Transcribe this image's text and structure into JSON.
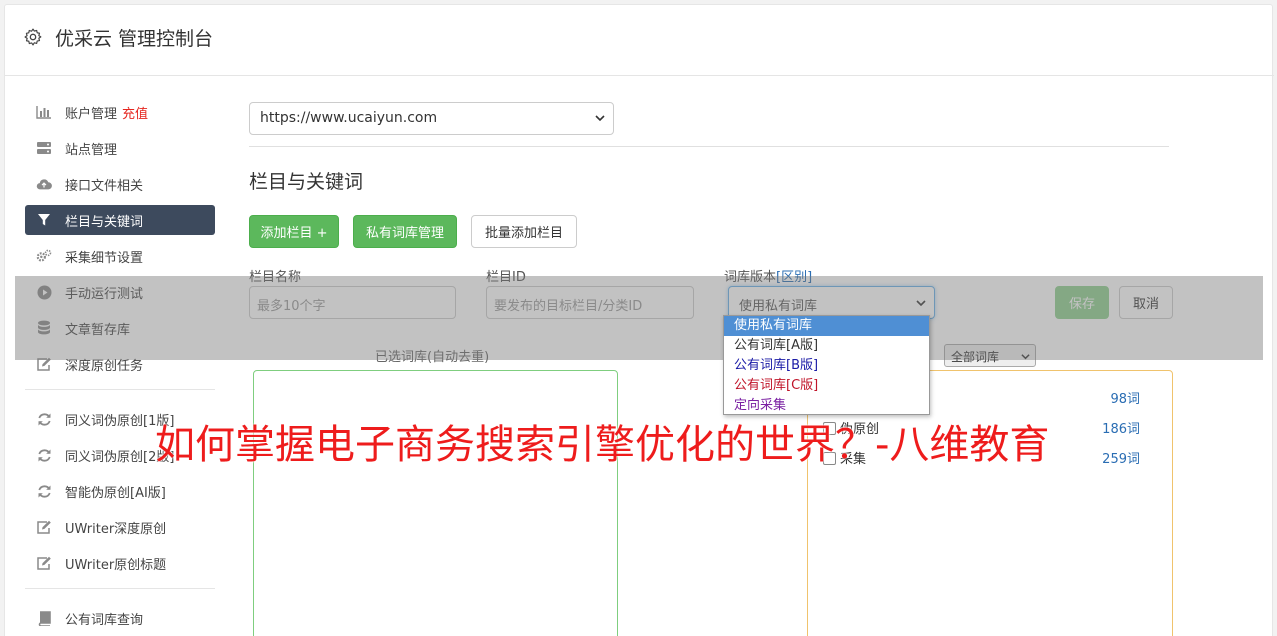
{
  "header": {
    "title": "优采云 管理控制台",
    "icon": "gear-icon"
  },
  "sidebar": {
    "items": [
      {
        "label": "账户管理",
        "badge": "充值",
        "icon": "bar-chart-icon"
      },
      {
        "label": "站点管理",
        "icon": "server-icon"
      },
      {
        "label": "接口文件相关",
        "icon": "cloud-upload-icon"
      },
      {
        "label": "栏目与关键词",
        "icon": "filter-icon",
        "active": true
      },
      {
        "label": "采集细节设置",
        "icon": "cogs-icon"
      },
      {
        "label": "手动运行测试",
        "icon": "play-circle-icon"
      },
      {
        "label": "文章暂存库",
        "icon": "database-icon"
      },
      {
        "label": "深度原创任务",
        "icon": "edit-icon"
      }
    ],
    "items2": [
      {
        "label": "同义词伪原创[1版]",
        "icon": "refresh-icon"
      },
      {
        "label": "同义词伪原创[2版]",
        "icon": "refresh-icon"
      },
      {
        "label": "智能伪原创[AI版]",
        "icon": "refresh-icon"
      },
      {
        "label": "UWriter深度原创",
        "icon": "edit-icon"
      },
      {
        "label": "UWriter原创标题",
        "icon": "edit-icon"
      }
    ],
    "items3": [
      {
        "label": "公有词库查询",
        "icon": "book-icon"
      }
    ]
  },
  "main": {
    "site_select": "https://www.ucaiyun.com",
    "section_title": "栏目与关键词",
    "buttons": {
      "add_column": "添加栏目 +",
      "private_lib": "私有词库管理",
      "batch_add": "批量添加栏目",
      "save": "保存",
      "cancel": "取消"
    },
    "form": {
      "name_label": "栏目名称",
      "name_placeholder": "最多10个字",
      "id_label": "栏目ID",
      "id_placeholder": "要发布的目标栏目/分类ID",
      "lib_label": "词库版本",
      "lib_link": "[区别]",
      "lib_value": "使用私有词库"
    },
    "dropdown_options": [
      {
        "label": "使用私有词库",
        "color": "#ffffff",
        "selected": true
      },
      {
        "label": "公有词库[A版]",
        "color": "#333333"
      },
      {
        "label": "公有词库[B版]",
        "color": "#1a1aa6"
      },
      {
        "label": "公有词库[C版]",
        "color": "#c0152a"
      },
      {
        "label": "定向采集",
        "color": "#7a1fa2"
      }
    ],
    "selected_lib_title": "已选词库(自动去重)",
    "all_lib_select": "全部词库",
    "lib_rows": [
      {
        "label": "",
        "count": "98词"
      },
      {
        "label": "伪原创",
        "count": "186词"
      },
      {
        "label": "采集",
        "count": "259词"
      }
    ]
  },
  "watermark": "如何掌握电子商务搜索引擎优化的世界？-八维教育"
}
